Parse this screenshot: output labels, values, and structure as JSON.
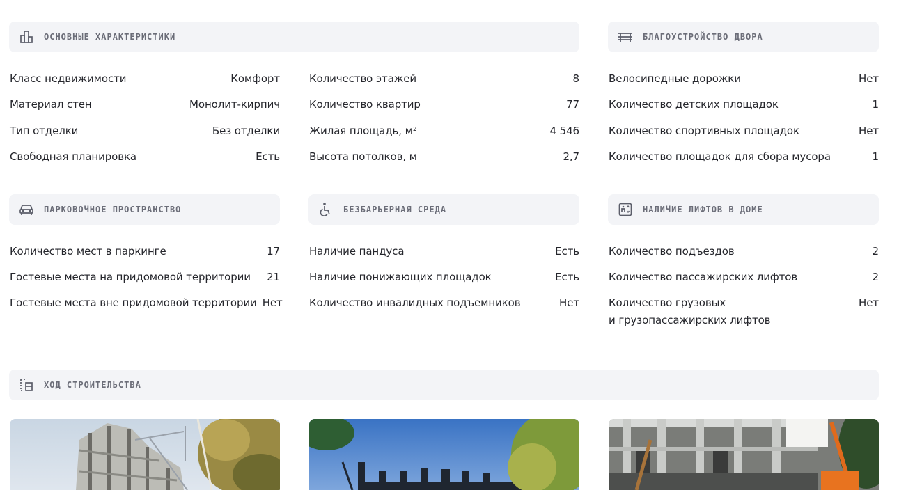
{
  "sections": {
    "main": {
      "title": "Основные характеристики",
      "icon": "building-icon",
      "rows_left": [
        {
          "label": "Класс недвижимости",
          "value": "Комфорт"
        },
        {
          "label": "Материал стен",
          "value": "Монолит-кирпич"
        },
        {
          "label": "Тип отделки",
          "value": "Без отделки"
        },
        {
          "label": "Свободная планировка",
          "value": "Есть"
        }
      ],
      "rows_right": [
        {
          "label": "Количество этажей",
          "value": "8"
        },
        {
          "label": "Количество квартир",
          "value": "77"
        },
        {
          "label": "Жилая площадь, м²",
          "value": "4 546"
        },
        {
          "label": "Высота потолков, м",
          "value": "2,7"
        }
      ]
    },
    "yard": {
      "title": "Благоустройство двора",
      "icon": "bench-icon",
      "rows": [
        {
          "label": "Велосипедные дорожки",
          "value": "Нет"
        },
        {
          "label": "Количество детских площадок",
          "value": "1"
        },
        {
          "label": "Количество спортивных площадок",
          "value": "Нет"
        },
        {
          "label": "Количество площадок для сбора мусора",
          "value": "1"
        }
      ]
    },
    "parking": {
      "title": "Парковочное пространство",
      "icon": "car-icon",
      "rows": [
        {
          "label": "Количество мест в паркинге",
          "value": "17"
        },
        {
          "label": "Гостевые места на придомовой территории",
          "value": "21"
        },
        {
          "label": "Гостевые места вне придомовой территории",
          "value": "Нет"
        }
      ]
    },
    "barrier_free": {
      "title": "Безбарьерная среда",
      "icon": "wheelchair-icon",
      "rows": [
        {
          "label": "Наличие пандуса",
          "value": "Есть"
        },
        {
          "label": "Наличие понижающих площадок",
          "value": "Есть"
        },
        {
          "label": "Количество инвалидных подъемников",
          "value": "Нет"
        }
      ]
    },
    "elevators": {
      "title": "Наличие лифтов в доме",
      "icon": "elevator-icon",
      "rows": [
        {
          "label": "Количество подъездов",
          "value": "2"
        },
        {
          "label": "Количество пассажирских лифтов",
          "value": "2"
        },
        {
          "label_line1": "Количество грузовых",
          "label_line2": "и грузопассажирских лифтов",
          "value": "Нет"
        }
      ]
    },
    "construction": {
      "title": "Ход строительства",
      "icon": "construction-progress-icon",
      "photos": [
        "construction-photo-1",
        "construction-photo-2",
        "construction-photo-3"
      ]
    }
  },
  "colors": {
    "panel_bg": "#f3f4f7",
    "panel_title": "#6b6d78",
    "text": "#25262c",
    "icon": "#5b5e6a"
  }
}
